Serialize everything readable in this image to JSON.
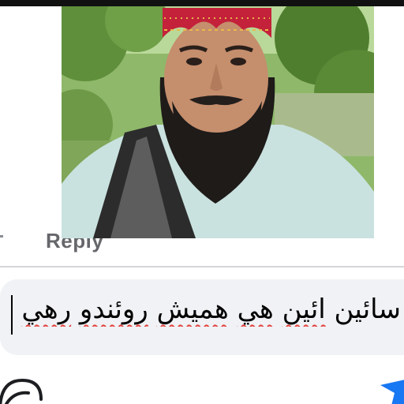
{
  "post": {
    "photo_alt": "selfie-photo"
  },
  "comment_actions": {
    "reply_label": "Reply"
  },
  "composer": {
    "text_words": [
      "سائين",
      "ائين",
      "هي",
      "هميش",
      "روئندو",
      "رهي"
    ],
    "underlined_words": [
      1,
      2,
      3,
      4
    ]
  },
  "icons": {
    "bottom_left": "sticker-icon",
    "bottom_right": "send-icon"
  },
  "colors": {
    "composer_bg": "#f0f2f5",
    "reply_text": "#65676b",
    "spellcheck_underline": "#e4413c",
    "send_accent": "#1877f2"
  }
}
